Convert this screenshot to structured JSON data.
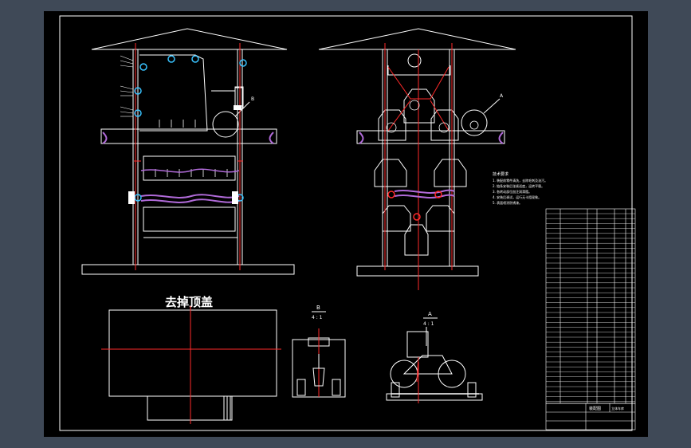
{
  "drawing": {
    "bottom_view_title": "去掉顶盖",
    "section_b_label": "B",
    "section_b_sub": "4 : 1",
    "section_a_label": "A",
    "section_a_sub": "4 : 1",
    "detail_b_label": "B",
    "detail_a_label": "A",
    "tech_req_title": "技术要求",
    "tech_req_lines": [
      "1. 装配前零件清洗，去除毛刺及油污。",
      "2. 链条安装后张紧适度，运转平稳。",
      "3. 各转动部位加注润滑脂。",
      "4. 安装后调试，运行无卡阻现象。",
      "5. 表面喷涂防锈漆。"
    ],
    "title_block_name": "装配图",
    "title_block_school": "立体车库"
  },
  "colors": {
    "app_bg": "#3f4957",
    "canvas": "#000000",
    "line": "#ffffff",
    "accent": "#ff2a2a",
    "chain": "#b06ad8"
  }
}
